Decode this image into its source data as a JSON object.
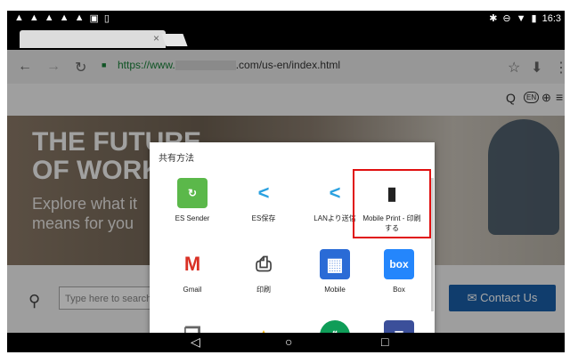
{
  "status_bar": {
    "time": "16:3"
  },
  "browser": {
    "tab_close": "×",
    "url_prefix": "https://www.",
    "url_suffix": ".com/us-en/index.html",
    "back_icon": "←",
    "forward_icon": "→",
    "reload_icon": "↻",
    "lock_icon": "🔒",
    "star_icon": "☆",
    "download_icon": "⬇",
    "menu_icon": "⋮"
  },
  "site": {
    "header_icons": [
      "Q",
      "EN",
      "⊕",
      "≡"
    ],
    "hero_title_line1": "THE FUTURE",
    "hero_title_line2": "OF WORK",
    "hero_sub_line1": "Explore what it",
    "hero_sub_line2": "means for you",
    "search_placeholder": "Type here to search",
    "contact_label": "Contact Us"
  },
  "share_sheet": {
    "title": "共有方法",
    "apps": [
      {
        "label": "ES Sender",
        "icon": "es-sender-icon",
        "color": "#5bb84a",
        "glyph": "↻"
      },
      {
        "label": "ES保存",
        "icon": "share-es-icon",
        "color": "#ffffff",
        "glyph": "<"
      },
      {
        "label": "LANより送信",
        "icon": "share-lan-icon",
        "color": "#ffffff",
        "glyph": "<"
      },
      {
        "label": "Mobile Print - 印刷する",
        "icon": "mobile-print-icon",
        "color": "#ffffff",
        "glyph": "▮"
      },
      {
        "label": "Gmail",
        "icon": "gmail-icon",
        "color": "#ffffff",
        "glyph": "M"
      },
      {
        "label": "印刷",
        "icon": "printer-icon",
        "color": "#ffffff",
        "glyph": "⎙"
      },
      {
        "label": "Mobile",
        "icon": "mobile-app-icon",
        "color": "#2a6bd6",
        "glyph": "▦"
      },
      {
        "label": "Box",
        "icon": "box-icon",
        "color": "#2486fc",
        "glyph": "box"
      },
      {
        "label": "",
        "icon": "copy-icon",
        "color": "#ffffff",
        "glyph": "❐"
      },
      {
        "label": "",
        "icon": "drive-icon",
        "color": "#ffffff",
        "glyph": "▲"
      },
      {
        "label": "",
        "icon": "hangouts-icon",
        "color": "#0f9d58",
        "glyph": "❝"
      },
      {
        "label": "",
        "icon": "fax-icon",
        "color": "#3b4f9a",
        "glyph": "☰"
      }
    ]
  },
  "nav": {
    "back": "◁",
    "home": "○",
    "recents": "□"
  }
}
